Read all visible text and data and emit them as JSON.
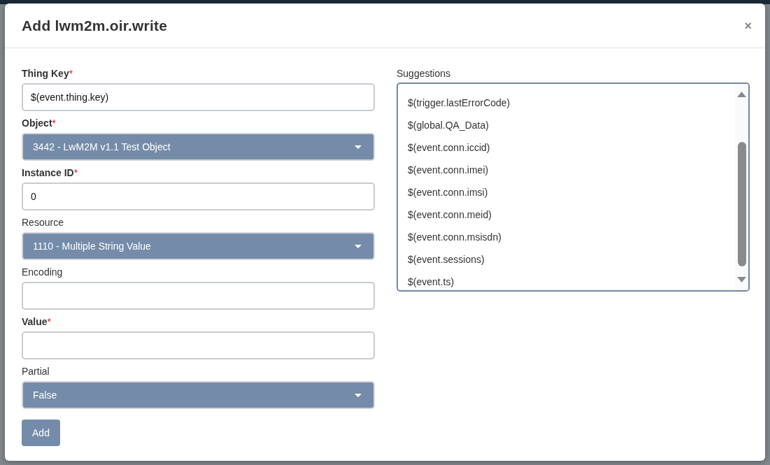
{
  "dialog": {
    "title": "Add lwm2m.oir.write",
    "close_label": "×"
  },
  "form": {
    "required_mark": "*",
    "fields": [
      {
        "kind": "text",
        "label": "Thing Key",
        "required": true,
        "value": "$(event.thing.key)"
      },
      {
        "kind": "select",
        "label": "Object",
        "required": true,
        "value": "3442 - LwM2M v1.1 Test Object"
      },
      {
        "kind": "text",
        "label": "Instance ID",
        "required": true,
        "value": "0"
      },
      {
        "kind": "select",
        "label": "Resource",
        "required": false,
        "value": "1110 - Multiple String Value"
      },
      {
        "kind": "text",
        "label": "Encoding",
        "required": false
      },
      {
        "kind": "text",
        "label": "Value",
        "required": true
      },
      {
        "kind": "select",
        "label": "Partial",
        "required": false,
        "value": "False"
      }
    ],
    "submit_label": "Add"
  },
  "suggestions": {
    "label": "Suggestions",
    "items": [
      {
        "text": "$(trigger.lastErrorCode)",
        "selected": false
      },
      {
        "text": "$(global.QA_Data)",
        "selected": false
      },
      {
        "text": "$(event.conn.iccid)",
        "selected": false
      },
      {
        "text": "$(event.conn.imei)",
        "selected": false
      },
      {
        "text": "$(event.conn.imsi)",
        "selected": false
      },
      {
        "text": "$(event.conn.meid)",
        "selected": false
      },
      {
        "text": "$(event.conn.msisdn)",
        "selected": false
      },
      {
        "text": "$(event.sessions)",
        "selected": false
      },
      {
        "text": "$(event.ts)",
        "selected": false
      }
    ]
  }
}
